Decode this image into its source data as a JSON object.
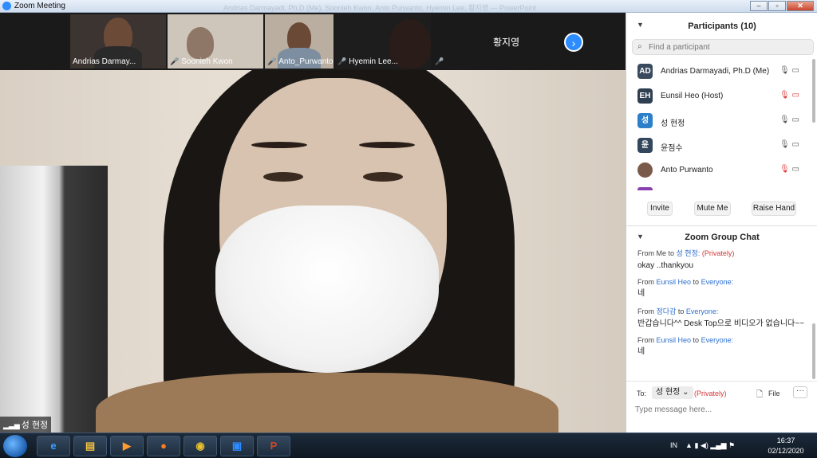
{
  "window": {
    "title": "Zoom Meeting",
    "faint_caption": "Andrias Darmayadi, Ph.D (Me), Soonieh Kwon, Anto Purwanto, Hyemin Lee, 황지영 — PowerPoint"
  },
  "thumbnails": [
    {
      "name": "Andrias Darmay...",
      "muted": false
    },
    {
      "name": "Soonieh Kwon",
      "muted": true
    },
    {
      "name": "Anto_Purwanto",
      "muted": true
    },
    {
      "name": "Hyemin Lee...",
      "muted": true
    },
    {
      "name": "황지영",
      "muted": true
    }
  ],
  "main_video": {
    "name": "성 현정"
  },
  "participants_panel": {
    "title": "Participants (10)",
    "search_placeholder": "Find a participant",
    "participants": [
      {
        "initials": "AD",
        "name": "Andrias Darmayadi, Ph.D (Me)",
        "avatar_color": "#3a4a5e",
        "mic": "on",
        "video": "on"
      },
      {
        "initials": "EH",
        "name": "Eunsil Heo (Host)",
        "avatar_color": "#2f3f52",
        "mic": "off",
        "video": "off"
      },
      {
        "initials": "성",
        "name": "성 현정",
        "avatar_color": "#2d7fc9",
        "mic": "on",
        "video": "on"
      },
      {
        "initials": "윤",
        "name": "윤점수",
        "avatar_color": "#33475c",
        "mic": "on",
        "video": "on"
      },
      {
        "initials": "",
        "name": "Anto Purwanto",
        "avatar_color": "#7a5a4a",
        "mic": "off",
        "video": "on"
      }
    ],
    "buttons": {
      "invite": "Invite",
      "mute_me": "Mute Me",
      "raise_hand": "Raise Hand"
    }
  },
  "chat_panel": {
    "title": "Zoom Group Chat",
    "messages": [
      {
        "from_label": "From Me to",
        "sender": "성 현정:",
        "recipient": "",
        "privately": "(Privately)",
        "text": "okay ..thankyou"
      },
      {
        "from_label": "From",
        "sender": "Eunsil Heo",
        "recipient": "Everyone:",
        "privately": "",
        "text": "네"
      },
      {
        "from_label": "From",
        "sender": "정다감",
        "recipient": "Everyone:",
        "privately": "",
        "text": "반갑습니다^^ Desk Top으로 비디오가 없습니다~~"
      },
      {
        "from_label": "From",
        "sender": "Eunsil Heo",
        "recipient": "Everyone:",
        "privately": "",
        "text": "네"
      }
    ],
    "to_label": "To:",
    "to_value": "성 현정",
    "to_privately": "(Privately)",
    "file_label": "File",
    "more_label": "···",
    "input_placeholder": "Type message here..."
  },
  "taskbar": {
    "items": [
      "ie-icon",
      "explorer-icon",
      "media-icon",
      "firefox-icon",
      "chrome-icon",
      "zoom-icon",
      "powerpoint-icon"
    ],
    "lang": "IN",
    "time": "16:37",
    "date": "02/12/2020"
  }
}
